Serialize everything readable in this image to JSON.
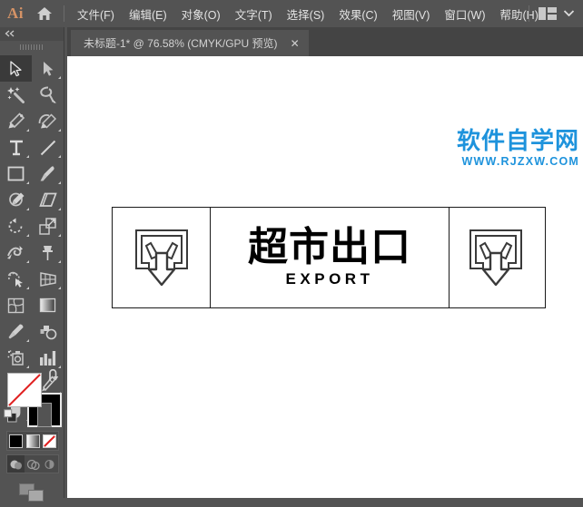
{
  "app": {
    "logo": "Ai",
    "home_icon": "home-icon",
    "workspace_icon": "workspace-layout-icon",
    "workspace_chevron": "chevron-down-icon"
  },
  "menubar": {
    "items": [
      {
        "label": "文件(F)",
        "name": "menu-file"
      },
      {
        "label": "编辑(E)",
        "name": "menu-edit"
      },
      {
        "label": "对象(O)",
        "name": "menu-object"
      },
      {
        "label": "文字(T)",
        "name": "menu-type"
      },
      {
        "label": "选择(S)",
        "name": "menu-select"
      },
      {
        "label": "效果(C)",
        "name": "menu-effect"
      },
      {
        "label": "视图(V)",
        "name": "menu-view"
      },
      {
        "label": "窗口(W)",
        "name": "menu-window"
      },
      {
        "label": "帮助(H)",
        "name": "menu-help"
      }
    ]
  },
  "tabbar": {
    "document_title": "未标题-1* @ 76.58% (CMYK/GPU 预览)",
    "close_label": "✕"
  },
  "toolbar": {
    "collapse_label": "«",
    "tools": [
      {
        "name": "selection-tool",
        "icon": "arrow-cursor-icon",
        "selected": true,
        "corner": false
      },
      {
        "name": "direct-selection-tool",
        "icon": "white-arrow-cursor-icon",
        "selected": false,
        "corner": true
      },
      {
        "name": "magic-wand-tool",
        "icon": "magic-wand-icon",
        "selected": false,
        "corner": false
      },
      {
        "name": "lasso-tool",
        "icon": "lasso-icon",
        "selected": false,
        "corner": false
      },
      {
        "name": "pen-tool",
        "icon": "pen-icon",
        "selected": false,
        "corner": true
      },
      {
        "name": "curvature-tool",
        "icon": "curvature-icon",
        "selected": false,
        "corner": true
      },
      {
        "name": "type-tool",
        "icon": "type-t-icon",
        "selected": false,
        "corner": true
      },
      {
        "name": "line-segment-tool",
        "icon": "line-icon",
        "selected": false,
        "corner": true
      },
      {
        "name": "rectangle-tool",
        "icon": "rectangle-icon",
        "selected": false,
        "corner": true
      },
      {
        "name": "paintbrush-tool",
        "icon": "paintbrush-icon",
        "selected": false,
        "corner": true
      },
      {
        "name": "shaper-tool",
        "icon": "shaper-pencil-icon",
        "selected": false,
        "corner": true
      },
      {
        "name": "eraser-tool",
        "icon": "eraser-icon",
        "selected": false,
        "corner": true
      },
      {
        "name": "rotate-tool",
        "icon": "rotate-icon",
        "selected": false,
        "corner": true
      },
      {
        "name": "scale-tool",
        "icon": "scale-icon",
        "selected": false,
        "corner": true
      },
      {
        "name": "width-tool",
        "icon": "width-warp-icon",
        "selected": false,
        "corner": true
      },
      {
        "name": "free-transform-tool",
        "icon": "pushpin-icon",
        "selected": false,
        "corner": true
      },
      {
        "name": "shape-builder-tool",
        "icon": "shape-builder-icon",
        "selected": false,
        "corner": true
      },
      {
        "name": "perspective-grid-tool",
        "icon": "perspective-grid-icon",
        "selected": false,
        "corner": true
      },
      {
        "name": "mesh-tool",
        "icon": "mesh-icon",
        "selected": false,
        "corner": false
      },
      {
        "name": "gradient-tool",
        "icon": "gradient-icon",
        "selected": false,
        "corner": false
      },
      {
        "name": "eyedropper-tool",
        "icon": "eyedropper-icon",
        "selected": false,
        "corner": true
      },
      {
        "name": "blend-tool",
        "icon": "blend-icon",
        "selected": false,
        "corner": false
      },
      {
        "name": "symbol-sprayer-tool",
        "icon": "symbol-sprayer-icon",
        "selected": false,
        "corner": true
      },
      {
        "name": "column-graph-tool",
        "icon": "bar-chart-icon",
        "selected": false,
        "corner": true
      },
      {
        "name": "artboard-tool",
        "icon": "artboard-icon",
        "selected": false,
        "corner": false
      },
      {
        "name": "slice-tool",
        "icon": "slice-knife-icon",
        "selected": false,
        "corner": true
      },
      {
        "name": "hand-tool",
        "icon": "hand-icon",
        "selected": false,
        "corner": true
      },
      {
        "name": "zoom-tool",
        "icon": "magnifier-icon",
        "selected": false,
        "corner": false
      }
    ],
    "fill_stroke": {
      "fill_name": "fill-swatch-none",
      "stroke_name": "stroke-swatch-black",
      "swap_icon": "swap-fill-stroke-icon",
      "default_icon": "default-fill-stroke-icon",
      "modes": [
        {
          "name": "color-mode-button",
          "icon": "solid-color-icon"
        },
        {
          "name": "gradient-mode-button",
          "icon": "gradient-swatch-icon"
        },
        {
          "name": "none-mode-button",
          "icon": "none-swatch-icon"
        }
      ],
      "draw_modes": [
        {
          "name": "draw-normal-button",
          "icon": "draw-normal-icon",
          "active": true
        },
        {
          "name": "draw-behind-button",
          "icon": "draw-behind-icon",
          "active": false
        },
        {
          "name": "draw-inside-button",
          "icon": "draw-inside-icon",
          "active": false
        }
      ],
      "screen_mode": {
        "name": "change-screen-mode-button",
        "icon": "screen-mode-icon"
      }
    }
  },
  "canvas": {
    "watermark": {
      "chinese": "软件自学网",
      "url": "WWW.RJZXW.COM",
      "color": "#1e93dc"
    },
    "artwork": {
      "name": "supermarket-exit-sign",
      "sign_chinese": "超市出口",
      "sign_english": "EXPORT",
      "left_icon": "exit-door-down-arrow-icon",
      "right_icon": "exit-door-down-arrow-icon",
      "stroke_color": "#1a1a1a",
      "background_color": "#ffffff"
    }
  },
  "colors": {
    "chrome": "#535353",
    "tabbar": "#444444",
    "accent_logo": "#d59366",
    "watermark_blue": "#1e93dc",
    "canvas_white": "#ffffff"
  }
}
